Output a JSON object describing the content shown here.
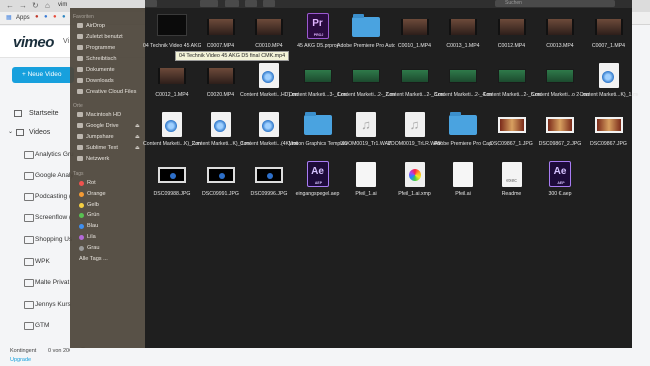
{
  "browser": {
    "apps_label": "Apps",
    "tab_title": "vim",
    "search_placeholder": "Suchen"
  },
  "vimeo": {
    "logo": "vimeo",
    "logo_suffix": "Vi",
    "new_video_label": "+ Neue Video",
    "nav": [
      "Startseite",
      "Videos"
    ],
    "folders": [
      "Analytics Gru",
      "Google Analy",
      "Podcasting (",
      "Screenflow (",
      "Shopping Us",
      "WPK",
      "Malte Privat",
      "Jennys Kurs",
      "GTM"
    ],
    "storage_label": "Kontingent",
    "storage_value": "0 von 20GB",
    "upgrade_label": "Upgrade"
  },
  "finder": {
    "sections": {
      "favorites": "Favoriten",
      "places": "Orte",
      "tags": "Tags"
    },
    "favorites": [
      "AirDrop",
      "Zuletzt benutzt",
      "Programme",
      "Schreibtisch",
      "Dokumente",
      "Downloads",
      "Creative Cloud Files"
    ],
    "places": [
      "Macintosh HD",
      "Google Drive",
      "Jumpshare",
      "Sublime Text",
      "Netzwerk"
    ],
    "tags": [
      {
        "name": "Rot",
        "color": "#f0524f"
      },
      {
        "name": "Orange",
        "color": "#f49a34"
      },
      {
        "name": "Gelb",
        "color": "#f6cf42"
      },
      {
        "name": "Grün",
        "color": "#58c152"
      },
      {
        "name": "Blau",
        "color": "#3f8ff0"
      },
      {
        "name": "Lila",
        "color": "#b36ad8"
      },
      {
        "name": "Grau",
        "color": "#9b9b9b"
      },
      {
        "name": "Alle Tags ...",
        "color": ""
      }
    ],
    "tooltip": "04 Technik Video 45 AKG D5 final CMK.mp4",
    "files": [
      {
        "name": "04 Technik Video 45 AKG...MP4",
        "kind": "black"
      },
      {
        "name": "C0007.MP4",
        "kind": "video"
      },
      {
        "name": "C0010.MP4",
        "kind": "video"
      },
      {
        "name": "45 AKG D5.prproj",
        "kind": "premiere"
      },
      {
        "name": "Adobe Premiere Pro Auto-Save",
        "kind": "folder"
      },
      {
        "name": "C0010_1.MP4",
        "kind": "video"
      },
      {
        "name": "C0013_1.MP4",
        "kind": "video"
      },
      {
        "name": "C0012.MP4",
        "kind": "video"
      },
      {
        "name": "C0013.MP4",
        "kind": "video"
      },
      {
        "name": "C0007_1.MP4",
        "kind": "video"
      },
      {
        "name": "C0012_1.MP4",
        "kind": "video"
      },
      {
        "name": "C0020.MP4",
        "kind": "video"
      },
      {
        "name": "Content Marketi...HD).mov",
        "kind": "quicktime"
      },
      {
        "name": "Content Marketi...3-_1.mov",
        "kind": "green"
      },
      {
        "name": "Content Marketi...2-_2.mov",
        "kind": "green"
      },
      {
        "name": "Content Marketi...2-_3.mov",
        "kind": "green"
      },
      {
        "name": "Content Marketi...2-_4.mov",
        "kind": "green"
      },
      {
        "name": "Content Marketi...2-_5.mov",
        "kind": "green"
      },
      {
        "name": "Content Marketi...o 2-.mov",
        "kind": "green"
      },
      {
        "name": "Content Marketi...K)_1.mov",
        "kind": "quicktime"
      },
      {
        "name": "Content Marketi...K)_2.mov",
        "kind": "quicktime"
      },
      {
        "name": "Content Marketi...K)_3.mov",
        "kind": "quicktime"
      },
      {
        "name": "Content Marketi...(4K).mov",
        "kind": "quicktime"
      },
      {
        "name": "Motion Graphics Template Media",
        "kind": "folder"
      },
      {
        "name": "ZOOM0019_Tr1.WAV",
        "kind": "music"
      },
      {
        "name": "ZOOM0019_TrLR.WAV",
        "kind": "music"
      },
      {
        "name": "Adobe Premiere Pro Cap...ed Video",
        "kind": "folder"
      },
      {
        "name": "DSC09867_1.JPG",
        "kind": "red"
      },
      {
        "name": "DSC09867_2.JPG",
        "kind": "red"
      },
      {
        "name": "DSC09867.JPG",
        "kind": "red"
      },
      {
        "name": "DSC09988.JPG",
        "kind": "dark"
      },
      {
        "name": "DSC09991.JPG",
        "kind": "dark"
      },
      {
        "name": "DSC09996.JPG",
        "kind": "dark"
      },
      {
        "name": "eingangspegel.aep",
        "kind": "aftereffects"
      },
      {
        "name": "Pfeil_1.ai",
        "kind": "doc"
      },
      {
        "name": "Pfeil_1.ai.xmp",
        "kind": "photo"
      },
      {
        "name": "Pfeil.ai",
        "kind": "doc"
      },
      {
        "name": "Readme",
        "kind": "exec"
      },
      {
        "name": "300 €.aep",
        "kind": "aftereffects"
      }
    ]
  }
}
